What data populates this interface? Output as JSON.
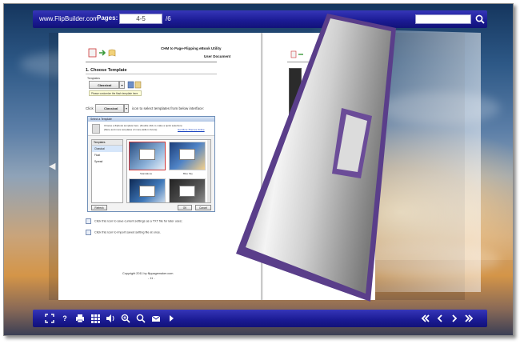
{
  "topbar": {
    "brand": "www.FlipBuilder.com",
    "pages_label": "Pages:",
    "page_value": "4-5",
    "page_total": "/6",
    "search_placeholder": ""
  },
  "document": {
    "header_title": "CHM to Page-Flipping eBook Utility",
    "header_subtitle": "User Document",
    "section_title": "1. Choose Template",
    "templates_label": "Templates",
    "combo_value": "Classical",
    "tip_text": "Please customize the flash template here.",
    "click_prefix": "Click",
    "click_combo": "Classical",
    "click_suffix": "icon to select templates from below interface:",
    "dialog": {
      "title": "Select a Template",
      "head_line1": "Choose a flipbook template here. (Double click to make a quick selection)",
      "head_line2": "(More and more templates of more-skills in future)",
      "link": "Get More Themes Online",
      "list_header": "Templates",
      "list_items": [
        "Classical",
        "Float",
        "Spread"
      ],
      "thumb_labels": [
        "Standalone",
        "Blue Sky"
      ],
      "refresh": "Refresh",
      "ok": "OK",
      "cancel": "Cancel"
    },
    "note_save": "Click this icon to save current settings as a TXT file for later uses;",
    "note_import": "Click this icon to import saved setting file at once.",
    "footer_copyright": "Copyright 2011 by flippagemaker.com",
    "footer_page": "- 11 -"
  },
  "colors": {
    "toolbar": "#1c1c96",
    "curl_edge": "#5a3e8a",
    "page_bg": "#ffffff"
  },
  "toolbar_icons": {
    "left": [
      "fit-screen-icon",
      "help-icon",
      "print-icon",
      "thumbnails-icon",
      "sound-icon",
      "zoom-in-icon",
      "search-icon",
      "email-icon",
      "autoplay-icon"
    ],
    "right": [
      "first-page-icon",
      "previous-page-icon",
      "next-page-icon",
      "last-page-icon"
    ]
  }
}
